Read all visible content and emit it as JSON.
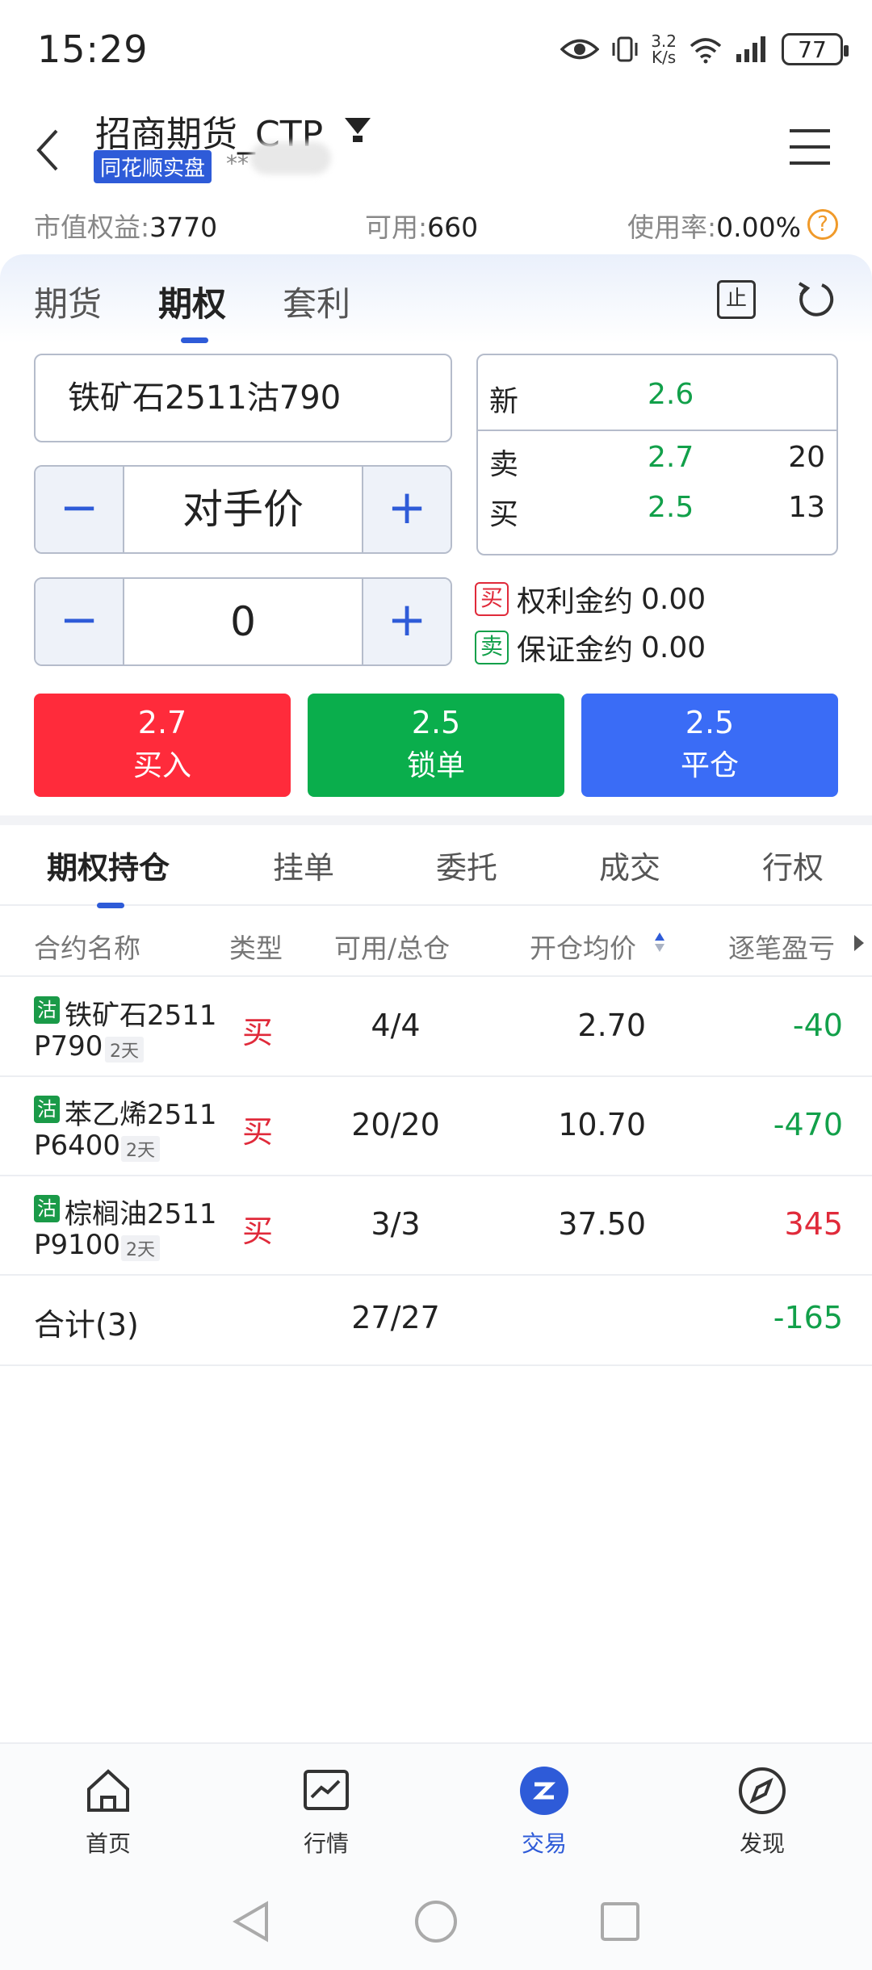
{
  "status_bar": {
    "time": "15:29",
    "speed_top": "3.2",
    "speed_bottom": "K/s",
    "battery": "77"
  },
  "header": {
    "title": "招商期货_CTP",
    "badge": "同花顺实盘",
    "account_masked": "**"
  },
  "summary": {
    "equity_label": "市值权益:",
    "equity_value": "3770",
    "available_label": "可用:",
    "available_value": "660",
    "usage_label": "使用率:",
    "usage_value": "0.00%",
    "help": "?"
  },
  "top_tabs": [
    "期货",
    "期权",
    "套利"
  ],
  "stop_label": "止",
  "order": {
    "contract": "铁矿石2511沽790",
    "price_type": "对手价",
    "quantity": "0",
    "minus": "−",
    "plus": "+"
  },
  "quote": {
    "last_label": "新",
    "last_price": "2.6",
    "ask_label": "卖",
    "ask_price": "2.7",
    "ask_vol": "20",
    "bid_label": "买",
    "bid_price": "2.5",
    "bid_vol": "13"
  },
  "margin": {
    "premium_tag": "买",
    "premium_label": "权利金约",
    "premium_value": "0.00",
    "deposit_tag": "卖",
    "deposit_label": "保证金约",
    "deposit_value": "0.00"
  },
  "actions": {
    "buy_price": "2.7",
    "buy_label": "买入",
    "lock_price": "2.5",
    "lock_label": "锁单",
    "close_price": "2.5",
    "close_label": "平仓"
  },
  "position_tabs": [
    "期权持仓",
    "挂单",
    "委托",
    "成交",
    "行权"
  ],
  "table": {
    "headers": [
      "合约名称",
      "类型",
      "可用/总仓",
      "开仓均价",
      "逐笔盈亏"
    ],
    "rows": [
      {
        "exchange": "沽",
        "name": "铁矿石2511",
        "code": "P790",
        "days": "2天",
        "type": "买",
        "qty": "4/4",
        "avg": "2.70",
        "pnl": "-40"
      },
      {
        "exchange": "沽",
        "name": "苯乙烯2511",
        "code": "P6400",
        "days": "2天",
        "type": "买",
        "qty": "20/20",
        "avg": "10.70",
        "pnl": "-470"
      },
      {
        "exchange": "沽",
        "name": "棕榈油2511",
        "code": "P9100",
        "days": "2天",
        "type": "买",
        "qty": "3/3",
        "avg": "37.50",
        "pnl": "345"
      }
    ],
    "total_label": "合计(3)",
    "total_qty": "27/27",
    "total_pnl": "-165"
  },
  "bottom_nav": [
    "首页",
    "行情",
    "交易",
    "发现"
  ],
  "colors": {
    "accent": "#2e5bd8",
    "buy_red": "#ff2b3b",
    "lock_green": "#0aae4c",
    "close_blue": "#3a6cf6",
    "loss_green": "#12a04a",
    "profit_red": "#e02a3a"
  }
}
